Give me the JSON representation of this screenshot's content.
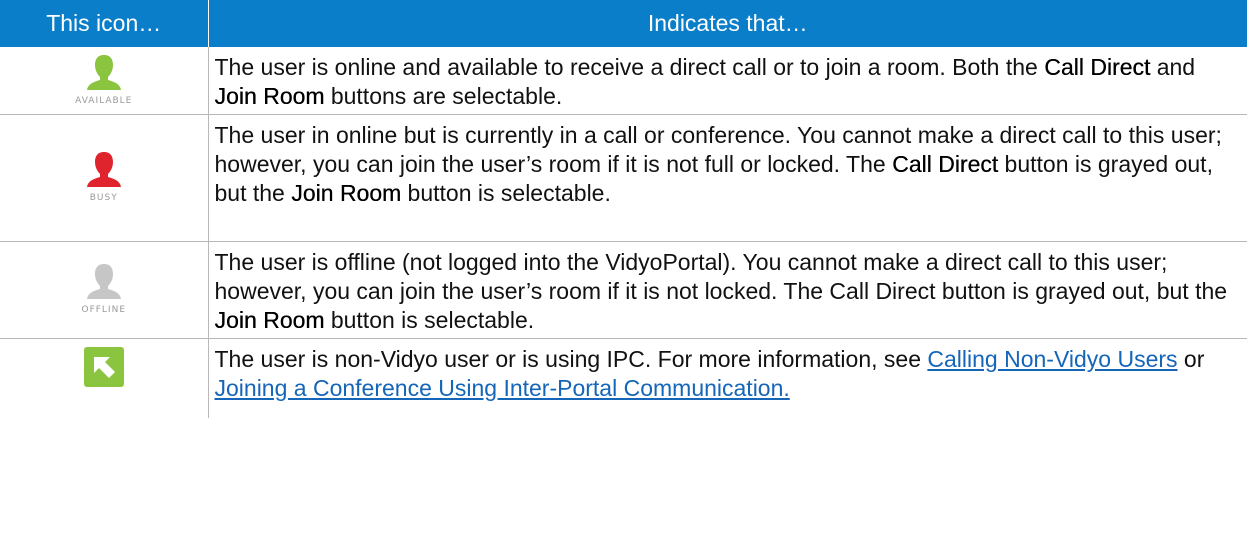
{
  "header": {
    "col_icon": "This icon…",
    "col_desc": "Indicates that…"
  },
  "colors": {
    "header_bg": "#0a7ec8",
    "available": "#8bc53f",
    "busy": "#e0242e",
    "offline": "#c6c6c6",
    "ipc": "#8bc53f"
  },
  "rows": [
    {
      "icon": "user-available-icon",
      "label": "AVAILABLE",
      "t1": "The user is online and available to receive a direct call or to join a room. Both the ",
      "b1": "Call Direct",
      "t2": " and ",
      "b2": "Join Room",
      "t3": " buttons are selectable."
    },
    {
      "icon": "user-busy-icon",
      "label": "BUSY",
      "t1": "The user in online but is currently in a call or conference. You cannot make a direct call to this user; however, you can join the user’s room if it is not full or locked. The ",
      "b1": "Call Direct",
      "t2": " button is grayed out, but the ",
      "b2": "Join Room",
      "t3": " button is selectable."
    },
    {
      "icon": "user-offline-icon",
      "label": "OFFLINE",
      "t1": "The user is offline (not logged into the VidyoPortal). You cannot make a direct call to this user; however, you can join the user’s room if it is not locked. The Call Direct button is grayed out, but the ",
      "b1": "Join Room",
      "t2": " button is selectable."
    },
    {
      "icon": "ipc-arrow-icon",
      "t1": "The user is non-Vidyo user or is using IPC. For more information, see ",
      "link1": "Calling Non-Vidyo Users",
      "t2": " or ",
      "link2": "Joining a Conference Using Inter-Portal Communication."
    }
  ]
}
